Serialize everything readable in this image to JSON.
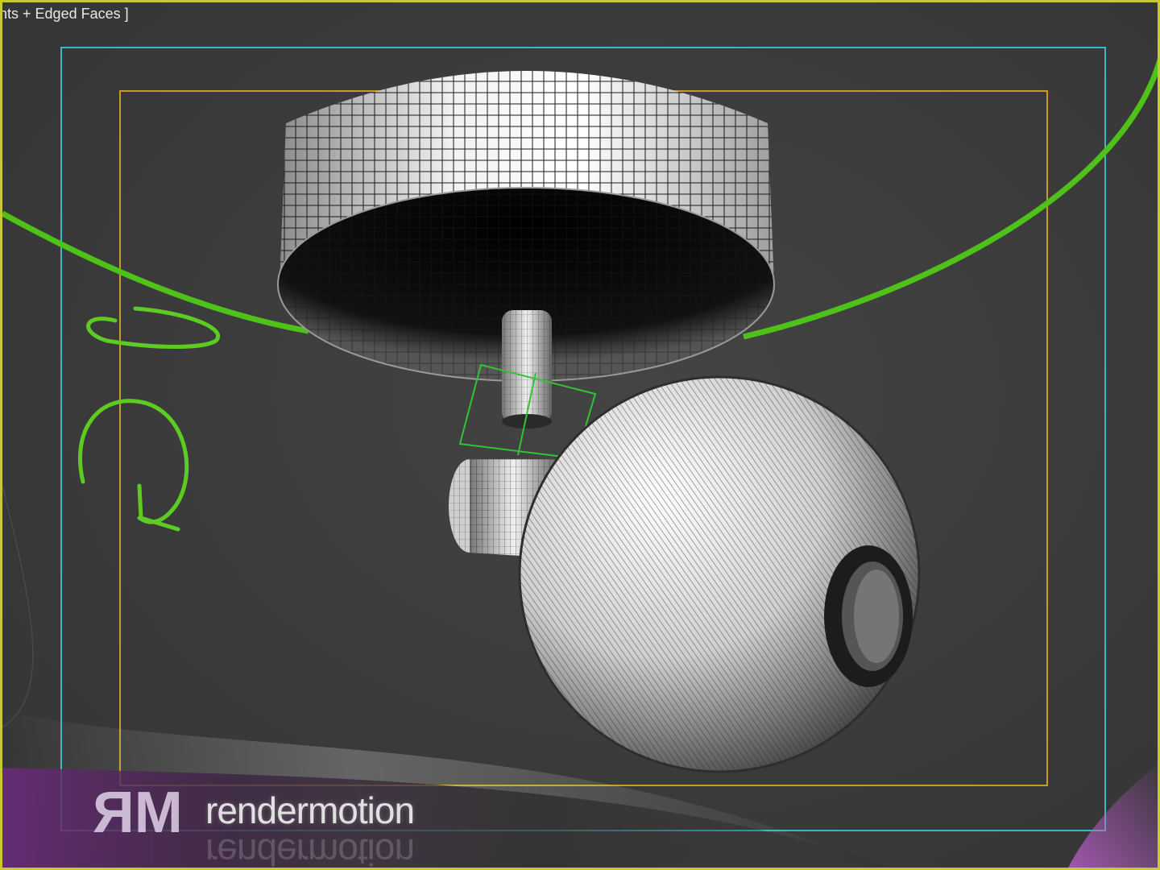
{
  "viewport": {
    "label": "ghts + Edged Faces ]",
    "border_color": "#c8c832",
    "safe_frame_outer_color": "#3ab6c8",
    "safe_frame_inner_color": "#c89a2a",
    "selection_color": "#5ad22a"
  },
  "watermark": {
    "logo_mark": "ЯM",
    "brand": "rendermotion",
    "accent_color": "#b45cc8"
  },
  "scene_objects": [
    "ceiling-canopy",
    "stem",
    "spotlight-sphere",
    "spotlight-neck",
    "selection-spline",
    "rotate-gizmo"
  ]
}
